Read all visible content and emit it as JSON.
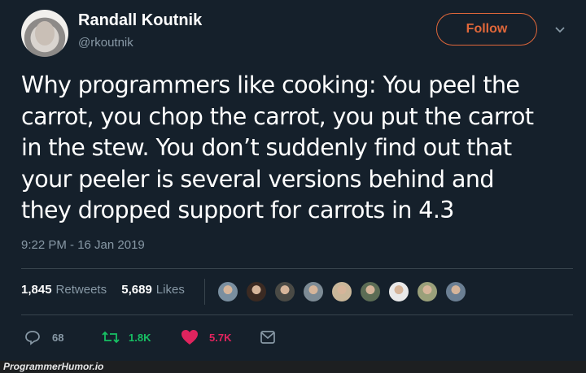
{
  "tweet": {
    "author_name": "Randall Koutnik",
    "author_handle": "@rkoutnik",
    "follow_label": "Follow",
    "text": "Why programmers like cooking:  You peel the\ncarrot, you chop the carrot, you put the carrot\nin the stew.  You don’t suddenly find out that\nyour peeler is several versions behind and\nthey dropped support for carrots in 4.3",
    "timestamp": "9:22 PM - 16 Jan 2019",
    "retweets_count": "1,845",
    "retweets_label": "Retweets",
    "likes_count": "5,689",
    "likes_label": "Likes",
    "liker_avatar_colors": [
      "#7a8fa0",
      "#3b2a22",
      "#4a4a45",
      "#7d8b95",
      "#c9b79a",
      "#5c6d55",
      "#e9e9e9",
      "#9aa07a",
      "#6b7f93"
    ],
    "actions": {
      "reply_count": "68",
      "retweet_count": "1.8K",
      "like_count": "5.7K"
    }
  },
  "colors": {
    "background": "#15202b",
    "follow_accent": "#e0673a",
    "retweet_green": "#17bf63",
    "like_pink": "#e0245e",
    "muted": "#8899a6"
  },
  "icons": [
    "chevron-down-icon",
    "reply-icon",
    "retweet-icon",
    "heart-icon",
    "message-icon"
  ],
  "watermark": "ProgrammerHumor.io"
}
